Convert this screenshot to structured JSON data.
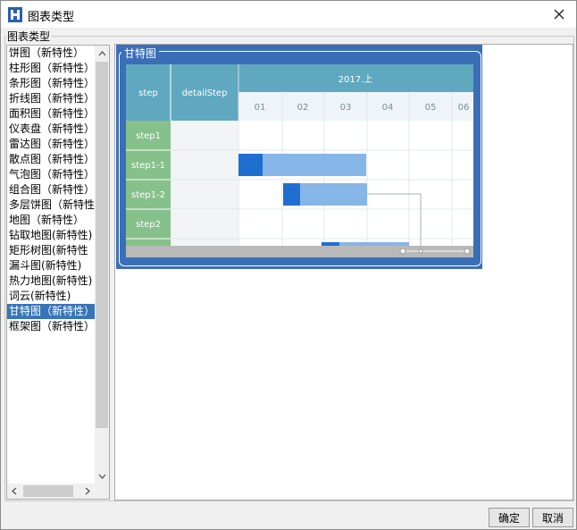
{
  "window": {
    "title": "图表类型"
  },
  "group_label": "图表类型",
  "chart_types": [
    "饼图（新特性）",
    "柱形图（新特性）",
    "条形图（新特性）",
    "折线图（新特性）",
    "面积图（新特性）",
    "仪表盘（新特性）",
    "雷达图（新特性）",
    "散点图（新特性）",
    "气泡图（新特性）",
    "组合图（新特性）",
    "多层饼图（新特性",
    "地图（新特性）",
    "钻取地图(新特性)",
    "矩形树图(新特性",
    "漏斗图(新特性)",
    "热力地图(新特性)",
    "词云(新特性)",
    "甘特图（新特性）",
    "框架图（新特性）"
  ],
  "selected_index": 17,
  "preview": {
    "label": "甘特图",
    "header": {
      "col1": "step",
      "col2": "detailStep",
      "period": "2017.上",
      "months": [
        "01",
        "02",
        "03",
        "04",
        "05",
        "06"
      ]
    },
    "rows": [
      "step1",
      "step1-1",
      "step1-2",
      "step2"
    ]
  },
  "buttons": {
    "ok": "确定",
    "cancel": "取消"
  },
  "colors": {
    "selection": "#3874b8",
    "preview_bg": "#3a6fb8",
    "header_teal": "#5fa8c0",
    "row_green": "#86c08a",
    "bar_light": "#86b5e8",
    "bar_dark": "#1f6fd0"
  }
}
